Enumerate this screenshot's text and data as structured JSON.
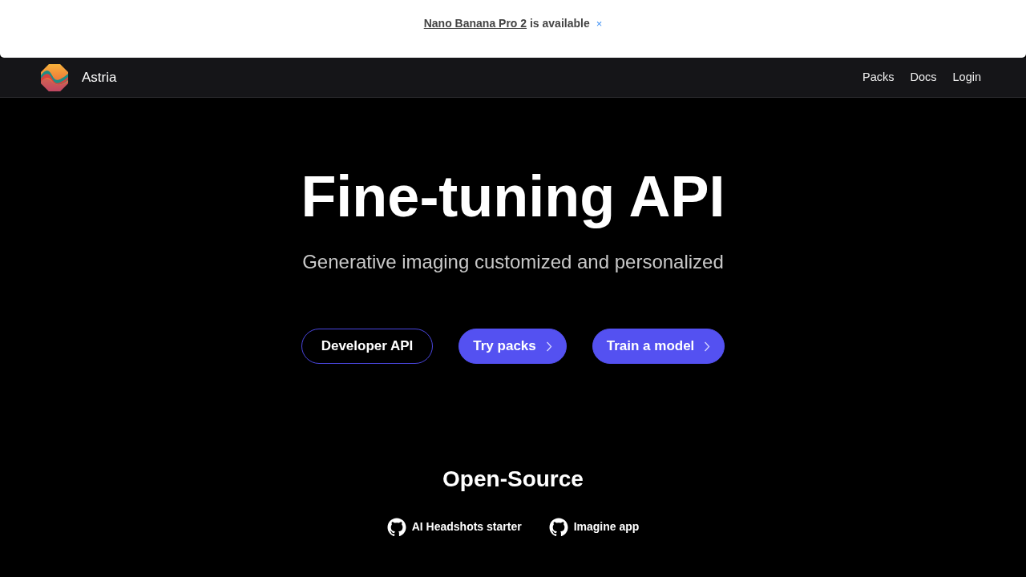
{
  "announcement": {
    "link_text": "Nano Banana Pro 2",
    "text": " is available",
    "close": "×"
  },
  "navbar": {
    "brand": "Astria",
    "links": [
      "Packs",
      "Docs",
      "Login"
    ]
  },
  "hero": {
    "title": "Fine-tuning API",
    "subtitle": "Generative imaging customized and personalized",
    "buttons": [
      {
        "label": "Developer API",
        "kind": "outline"
      },
      {
        "label": "Try packs",
        "kind": "solid"
      },
      {
        "label": "Train a model",
        "kind": "solid"
      }
    ]
  },
  "open_source": {
    "title": "Open-Source",
    "links": [
      "AI Headshots starter",
      "Imagine app"
    ]
  }
}
